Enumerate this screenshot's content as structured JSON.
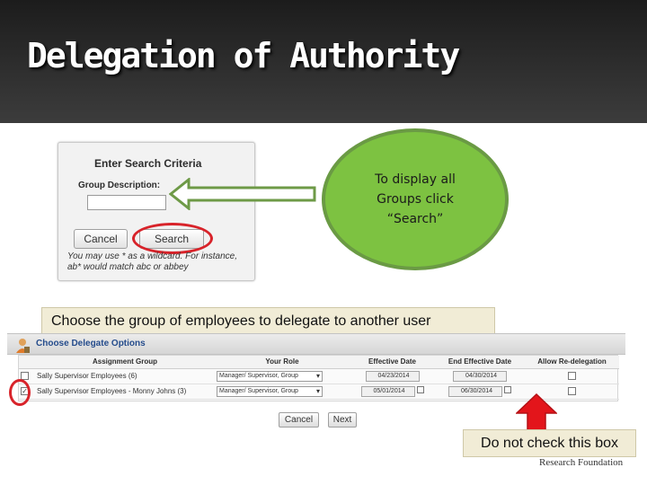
{
  "slide": {
    "title": "Delegation of Authority"
  },
  "search_panel": {
    "heading": "Enter Search Criteria",
    "field_label": "Group Description:",
    "field_value": "",
    "cancel_label": "Cancel",
    "search_label": "Search",
    "hint": "You may use * as a wildcard. For instance, ab* would match abc or abbey"
  },
  "callout": {
    "text": "To display all Groups click “Search”",
    "color": "#7dc241"
  },
  "caption": {
    "text": "Choose the group of  employees to delegate to another user"
  },
  "delegate_options": {
    "title": "Choose Delegate Options",
    "columns": [
      "Assignment Group",
      "Your Role",
      "Effective Date",
      "End Effective Date",
      "Allow Re-delegation"
    ],
    "rows": [
      {
        "checked": false,
        "group": "Sally Supervisor Employees (6)",
        "role": "Manager/ Supervisor, Group",
        "effective": "04/23/2014",
        "end": "04/30/2014"
      },
      {
        "checked": true,
        "group": "Sally Supervisor Employees - Monny Johns (3)",
        "role": "Manager/ Supervisor, Group",
        "effective": "05/01/2014",
        "end": "06/30/2014"
      }
    ],
    "cancel_label": "Cancel",
    "next_label": "Next"
  },
  "note": {
    "text": "Do not check this box"
  },
  "footer": {
    "logo_text": "Research Foundation"
  },
  "colors": {
    "header_bg": "#2e2e2e",
    "highlight_ring": "#d8232a",
    "note_bg": "#f1ecd6",
    "arrow_red": "#e3151b"
  }
}
